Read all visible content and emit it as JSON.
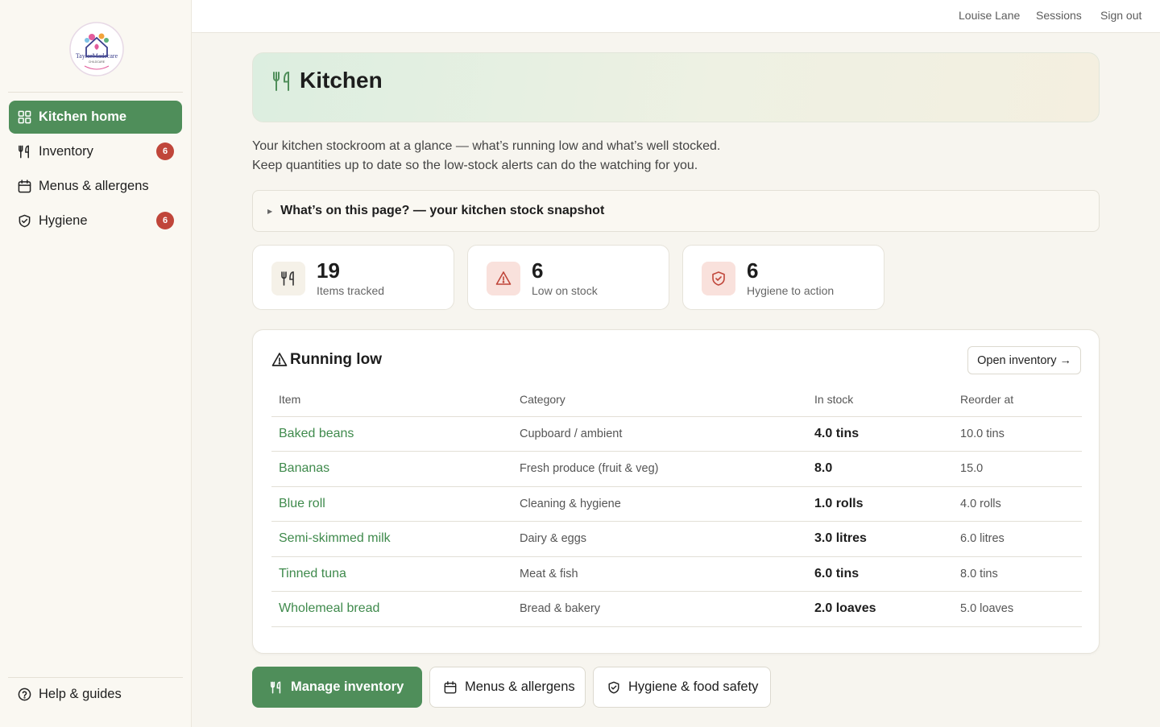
{
  "brand": {
    "logo_text": "TaylorMadecare",
    "logo_sub": "CHILDCARE"
  },
  "sidebar": {
    "items": [
      {
        "label": "Kitchen home",
        "icon": "grid-icon"
      },
      {
        "label": "Inventory",
        "icon": "cutlery-icon",
        "badge": "6"
      },
      {
        "label": "Menus & allergens",
        "icon": "calendar-icon"
      },
      {
        "label": "Hygiene",
        "icon": "shield-icon",
        "badge": "6"
      }
    ],
    "help_label": "Help & guides"
  },
  "topbar": {
    "user": "Louise Lane",
    "sessions": "Sessions",
    "signout": "Sign out"
  },
  "page": {
    "title": "Kitchen",
    "intro_line1": "Your kitchen stockroom at a glance — what’s running low and what’s well stocked.",
    "intro_line2": "Keep quantities up to date so the low-stock alerts can do the watching for you.",
    "details_summary": "What’s on this page? — your kitchen stock snapshot"
  },
  "stats": [
    {
      "value": "19",
      "label": "Items tracked",
      "icon": "cutlery-icon"
    },
    {
      "value": "6",
      "label": "Low on stock",
      "icon": "warning-icon"
    },
    {
      "value": "6",
      "label": "Hygiene to action",
      "icon": "shield-icon"
    }
  ],
  "running_low": {
    "title": "Running low",
    "open_button": "Open inventory →",
    "columns": [
      "Item",
      "Category",
      "In stock",
      "Reorder at"
    ],
    "rows": [
      {
        "item": "Baked beans",
        "category": "Cupboard / ambient",
        "in_stock": "4.0 tins",
        "reorder_at": "10.0 tins"
      },
      {
        "item": "Bananas",
        "category": "Fresh produce (fruit & veg)",
        "in_stock": "8.0",
        "reorder_at": "15.0"
      },
      {
        "item": "Blue roll",
        "category": "Cleaning & hygiene",
        "in_stock": "1.0 rolls",
        "reorder_at": "4.0 rolls"
      },
      {
        "item": "Semi-skimmed milk",
        "category": "Dairy & eggs",
        "in_stock": "3.0 litres",
        "reorder_at": "6.0 litres"
      },
      {
        "item": "Tinned tuna",
        "category": "Meat & fish",
        "in_stock": "6.0 tins",
        "reorder_at": "8.0 tins"
      },
      {
        "item": "Wholemeal bread",
        "category": "Bread & bakery",
        "in_stock": "2.0 loaves",
        "reorder_at": "5.0 loaves"
      }
    ]
  },
  "actions": {
    "manage_inventory": "Manage inventory",
    "menus_allergens": "Menus & allergens",
    "hygiene_food_safety": "Hygiene & food safety"
  },
  "colors": {
    "accent_green": "#4f8e5a",
    "badge_red": "#c0463a",
    "link_green": "#3f8a4c"
  }
}
